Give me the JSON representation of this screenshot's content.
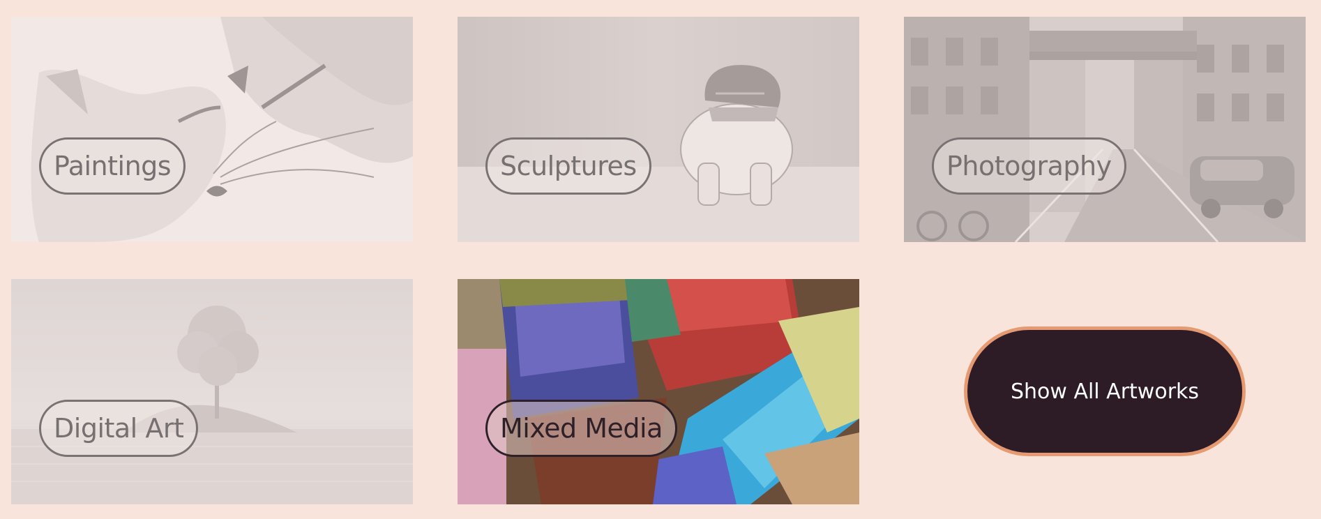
{
  "categories": [
    {
      "label": "Paintings",
      "image": "fox-watercolor"
    },
    {
      "label": "Sculptures",
      "image": "ceramic-lion-figurine"
    },
    {
      "label": "Photography",
      "image": "city-street-bridge"
    },
    {
      "label": "Digital Art",
      "image": "tree-on-island"
    },
    {
      "label": "Mixed Media",
      "image": "paint-brushes"
    }
  ],
  "show_all": {
    "label": "Show All Artworks"
  },
  "colors": {
    "background": "#f8e4da",
    "button_fill": "#2d1b26",
    "button_border": "#e59a72",
    "pill_border_muted": "#7a7272"
  }
}
